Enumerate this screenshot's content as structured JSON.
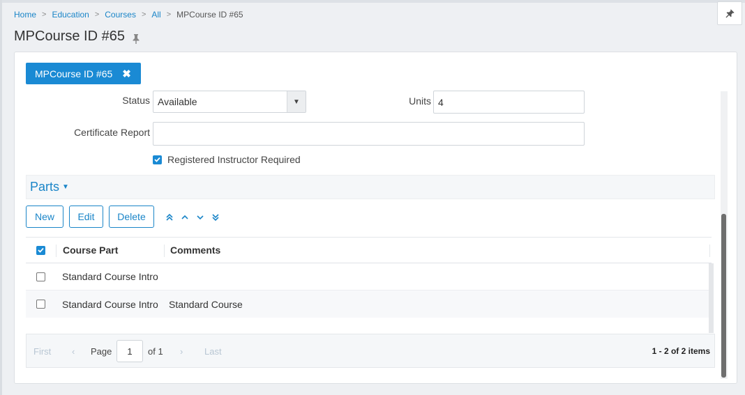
{
  "breadcrumb": {
    "items": [
      "Home",
      "Education",
      "Courses",
      "All"
    ],
    "current": "MPCourse ID #65"
  },
  "page": {
    "title": "MPCourse ID #65"
  },
  "tab": {
    "label": "MPCourse ID #65",
    "close_glyph": "✖"
  },
  "form": {
    "status_label": "Status",
    "status_value": "Available",
    "units_label": "Units",
    "units_value": "4",
    "certificate_label": "Certificate Report",
    "certificate_value": "",
    "registered_instructor_label": "Registered Instructor Required",
    "registered_instructor_checked": true
  },
  "parts": {
    "title": "Parts",
    "toolbar": {
      "new_label": "New",
      "edit_label": "Edit",
      "delete_label": "Delete"
    },
    "columns": [
      "Course Part",
      "Comments"
    ],
    "rows": [
      {
        "part": "Standard Course Intro",
        "comments": ""
      },
      {
        "part": "Standard Course Intro",
        "comments": "Standard Course"
      }
    ]
  },
  "pager": {
    "first": "First",
    "prev": "‹",
    "page_label": "Page",
    "page_value": "1",
    "of_label": "of 1",
    "next": "›",
    "last": "Last",
    "summary": "1 - 2 of 2 items"
  },
  "colors": {
    "accent": "#1a8ad4",
    "link": "#1a85c8",
    "background": "#eef0f3"
  },
  "icons": {
    "breadcrumb_separator": "chevron-right-icon",
    "pin": "pin-icon",
    "close": "close-icon",
    "move_top": "double-chevron-up-icon",
    "move_up": "chevron-up-icon",
    "move_down": "chevron-down-icon",
    "move_bottom": "double-chevron-down-icon"
  }
}
